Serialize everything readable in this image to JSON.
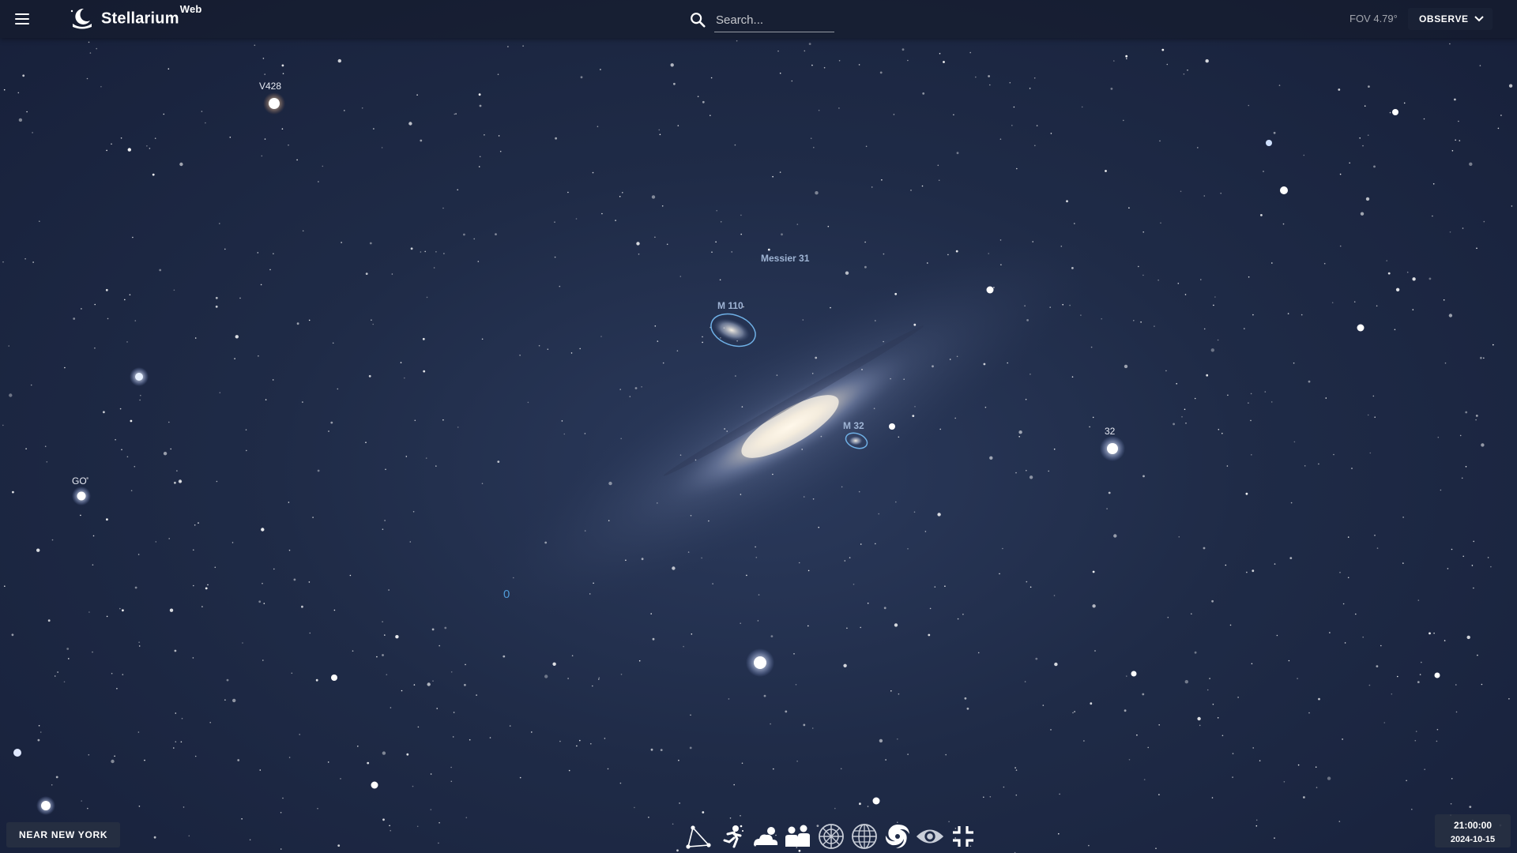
{
  "app": {
    "name": "Stellarium",
    "name_suffix": "Web"
  },
  "search": {
    "placeholder": "Search..."
  },
  "header": {
    "fov": "FOV 4.79°",
    "observe_label": "OBSERVE"
  },
  "sky_labels": {
    "v428": "V428",
    "messier31": "Messier 31",
    "m110": "M 110",
    "m32": "M 32",
    "star32": "32",
    "go": "GO",
    "zero": "0"
  },
  "footer": {
    "location": "NEAR NEW YORK",
    "time": "21:00:00",
    "date": "2024-10-15"
  },
  "toolbar": {
    "buttons": [
      "constellations-icon",
      "atmosphere-icon",
      "clouds-icon",
      "landscape-icon",
      "azimuthal-grid-icon",
      "equatorial-grid-icon",
      "dso-icon",
      "night-mode-icon",
      "fullscreen-icon"
    ]
  },
  "colors": {
    "sky": "#1f2b47",
    "accent": "#6fb0e6",
    "galaxy_core": "#f3ead8"
  }
}
